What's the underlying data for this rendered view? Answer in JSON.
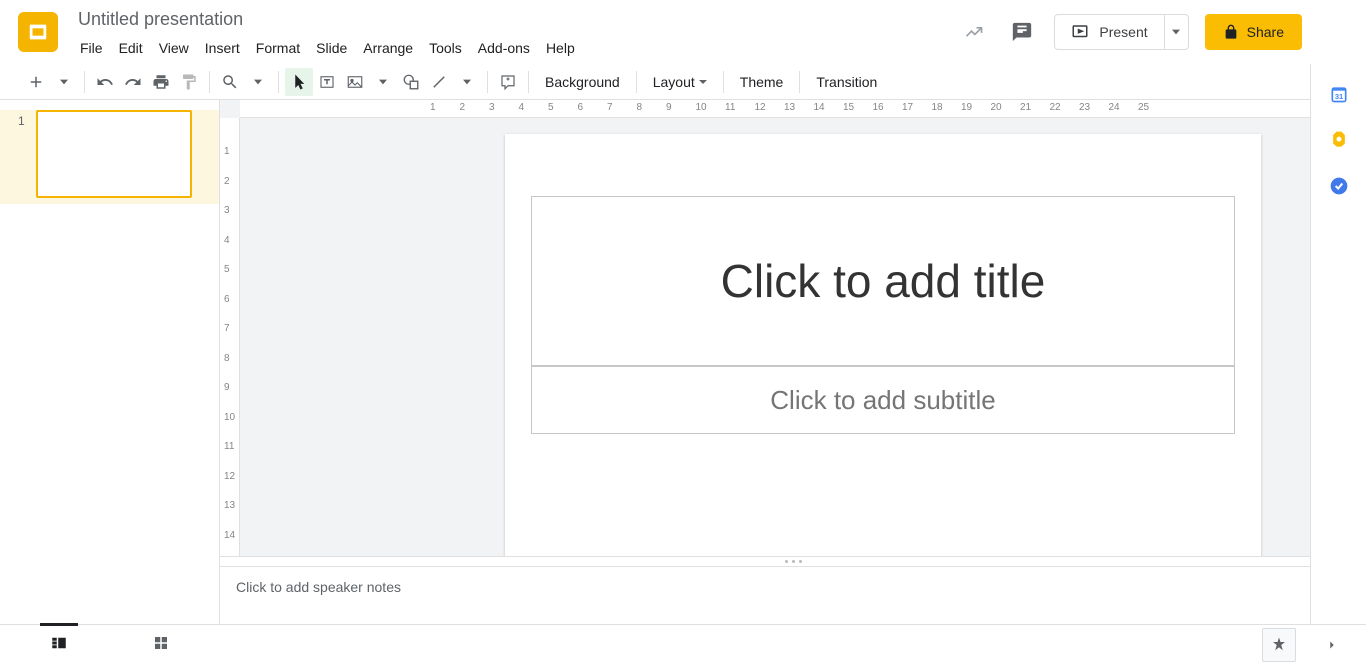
{
  "doc_title": "Untitled presentation",
  "menus": [
    "File",
    "Edit",
    "View",
    "Insert",
    "Format",
    "Slide",
    "Arrange",
    "Tools",
    "Add-ons",
    "Help"
  ],
  "present_label": "Present",
  "share_label": "Share",
  "toolbar_labels": {
    "background": "Background",
    "layout": "Layout",
    "theme": "Theme",
    "transition": "Transition"
  },
  "hruler": [
    "1",
    "2",
    "3",
    "4",
    "5",
    "6",
    "7",
    "8",
    "9",
    "10",
    "11",
    "12",
    "13",
    "14",
    "15",
    "16",
    "17",
    "18",
    "19",
    "20",
    "21",
    "22",
    "23",
    "24",
    "25"
  ],
  "vruler": [
    "1",
    "2",
    "3",
    "4",
    "5",
    "6",
    "7",
    "8",
    "9",
    "10",
    "11",
    "12",
    "13",
    "14"
  ],
  "slide": {
    "title_placeholder": "Click to add title",
    "subtitle_placeholder": "Click to add subtitle"
  },
  "notes_placeholder": "Click to add speaker notes",
  "thumbs": [
    {
      "num": "1"
    }
  ]
}
